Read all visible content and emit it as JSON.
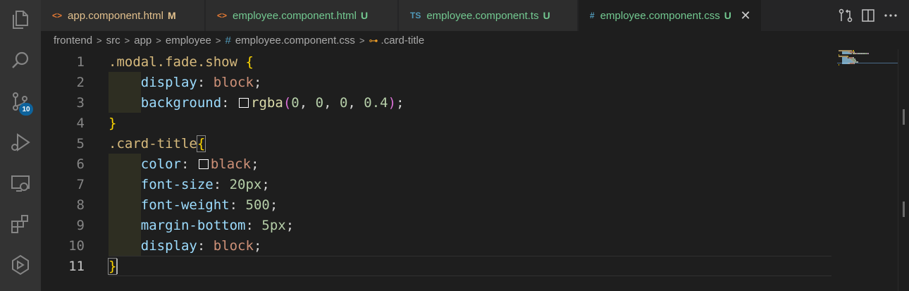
{
  "activity_bar": {
    "icons": [
      "explorer-icon",
      "search-icon",
      "source-control-icon",
      "run-debug-icon",
      "remote-explorer-icon",
      "extensions-icon",
      "devops-icon"
    ],
    "scm_badge": "10"
  },
  "tabs": [
    {
      "icon": "<>",
      "icon_color": "#e37933",
      "label": "app.component.html",
      "status": "M",
      "color": "#e2c08d",
      "active": false
    },
    {
      "icon": "<>",
      "icon_color": "#e37933",
      "label": "employee.component.html",
      "status": "U",
      "color": "#73c991",
      "active": false
    },
    {
      "icon": "TS",
      "icon_color": "#519aba",
      "label": "employee.component.ts",
      "status": "U",
      "color": "#73c991",
      "active": false
    },
    {
      "icon": "#",
      "icon_color": "#519aba",
      "label": "employee.component.css",
      "status": "U",
      "color": "#73c991",
      "active": true
    }
  ],
  "tab_close": "✕",
  "tab_actions": [
    "compare-changes-icon",
    "split-editor-icon",
    "more-actions-icon"
  ],
  "breadcrumb": {
    "folders": [
      "frontend",
      "src",
      "app",
      "employee"
    ],
    "file_icon": "#",
    "file": "employee.component.css",
    "symbol_icon": "⊶",
    "symbol": ".card-title"
  },
  "editor": {
    "current_line": 11,
    "lines": [
      {
        "n": "1",
        "tokens": [
          [
            "t-sel",
            ".modal.fade.show"
          ],
          [
            "t-punc",
            " "
          ],
          [
            "t-brace",
            "{"
          ]
        ]
      },
      {
        "n": "2",
        "tokens": [
          [
            "t-punc",
            "    "
          ],
          [
            "t-prop",
            "display"
          ],
          [
            "t-punc",
            ": "
          ],
          [
            "t-val",
            "block"
          ],
          [
            "t-punc",
            ";"
          ]
        ]
      },
      {
        "n": "3",
        "tokens": [
          [
            "t-punc",
            "    "
          ],
          [
            "t-prop",
            "background"
          ],
          [
            "t-punc",
            ": "
          ],
          [
            "swatch",
            ""
          ],
          [
            "t-fn",
            "rgba"
          ],
          [
            "t-paren",
            "("
          ],
          [
            "t-num",
            "0"
          ],
          [
            "t-punc",
            ", "
          ],
          [
            "t-num",
            "0"
          ],
          [
            "t-punc",
            ", "
          ],
          [
            "t-num",
            "0"
          ],
          [
            "t-punc",
            ", "
          ],
          [
            "t-num",
            "0.4"
          ],
          [
            "t-paren",
            ")"
          ],
          [
            "t-punc",
            ";"
          ]
        ]
      },
      {
        "n": "4",
        "tokens": [
          [
            "t-brace",
            "}"
          ]
        ]
      },
      {
        "n": "5",
        "tokens": [
          [
            "t-sel",
            ".card-title"
          ],
          [
            "t-brace brace-match",
            "{"
          ]
        ]
      },
      {
        "n": "6",
        "tokens": [
          [
            "t-punc",
            "    "
          ],
          [
            "t-prop",
            "color"
          ],
          [
            "t-punc",
            ": "
          ],
          [
            "swatch",
            ""
          ],
          [
            "t-val",
            "black"
          ],
          [
            "t-punc",
            ";"
          ]
        ]
      },
      {
        "n": "7",
        "tokens": [
          [
            "t-punc",
            "    "
          ],
          [
            "t-prop",
            "font-size"
          ],
          [
            "t-punc",
            ": "
          ],
          [
            "t-num",
            "20px"
          ],
          [
            "t-punc",
            ";"
          ]
        ]
      },
      {
        "n": "8",
        "tokens": [
          [
            "t-punc",
            "    "
          ],
          [
            "t-prop",
            "font-weight"
          ],
          [
            "t-punc",
            ": "
          ],
          [
            "t-num",
            "500"
          ],
          [
            "t-punc",
            ";"
          ]
        ]
      },
      {
        "n": "9",
        "tokens": [
          [
            "t-punc",
            "    "
          ],
          [
            "t-prop",
            "margin-bottom"
          ],
          [
            "t-punc",
            ": "
          ],
          [
            "t-num",
            "5px"
          ],
          [
            "t-punc",
            ";"
          ]
        ]
      },
      {
        "n": "10",
        "tokens": [
          [
            "t-punc",
            "    "
          ],
          [
            "t-prop",
            "display"
          ],
          [
            "t-punc",
            ": "
          ],
          [
            "t-val",
            "block"
          ],
          [
            "t-punc",
            ";"
          ]
        ]
      },
      {
        "n": "11",
        "tokens": [
          [
            "t-brace brace-match",
            "}"
          ],
          [
            "cursor",
            ""
          ]
        ]
      }
    ]
  }
}
